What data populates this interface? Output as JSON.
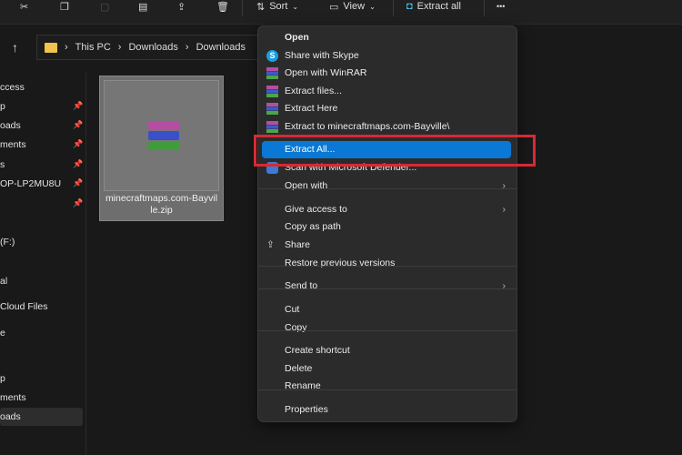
{
  "toolbar": {
    "sort": "Sort",
    "view": "View",
    "extract_all": "Extract all",
    "more": "•••"
  },
  "address": {
    "crumbs": [
      "This PC",
      "Downloads",
      "Downloads"
    ],
    "sep": "›"
  },
  "sidebar": {
    "items": [
      {
        "label": "ccess"
      },
      {
        "label": "p",
        "pinned": true
      },
      {
        "label": "oads",
        "pinned": true
      },
      {
        "label": "ments",
        "pinned": true
      },
      {
        "label": "s",
        "pinned": true
      },
      {
        "label": "OP-LP2MU8U",
        "pinned": true
      },
      {
        "label": "",
        "pinned": true
      },
      {
        "label": " (F:)"
      },
      {
        "label": "al"
      },
      {
        "label": " Cloud Files"
      },
      {
        "label": "e"
      },
      {
        "label": "p"
      },
      {
        "label": "ments"
      },
      {
        "label": "oads",
        "selected": true
      }
    ]
  },
  "file": {
    "name": "minecraftmaps.com-Bayville.zip",
    "name_line1": "minecraftmaps.com-Bayvil",
    "name_line2": "le.zip"
  },
  "menu": {
    "items": [
      {
        "label": "Open",
        "icon": "none"
      },
      {
        "label": "Share with Skype",
        "icon": "skype-icon"
      },
      {
        "label": "Open with WinRAR",
        "icon": "winrar-icon"
      },
      {
        "label": "Extract files...",
        "icon": "winrar-icon"
      },
      {
        "label": "Extract Here",
        "icon": "winrar-icon"
      },
      {
        "label": "Extract to minecraftmaps.com-Bayville\\",
        "icon": "winrar-icon"
      },
      {
        "label": "Extract All...",
        "icon": "none",
        "highlighted": true
      },
      {
        "label": "Scan with Microsoft Defender...",
        "icon": "defender-icon"
      },
      {
        "label": "Open with",
        "submenu": true
      },
      {
        "label": "Give access to",
        "submenu": true
      },
      {
        "label": "Copy as path"
      },
      {
        "label": "Share",
        "icon": "share-icon"
      },
      {
        "label": "Restore previous versions"
      },
      {
        "label": "Send to",
        "submenu": true
      },
      {
        "label": "Cut"
      },
      {
        "label": "Copy"
      },
      {
        "label": "Create shortcut"
      },
      {
        "label": "Delete"
      },
      {
        "label": "Rename"
      },
      {
        "label": "Properties"
      }
    ]
  },
  "colors": {
    "highlight": "#0a78d4",
    "annotation": "#d62a35",
    "menu_bg": "#2b2b2b"
  }
}
